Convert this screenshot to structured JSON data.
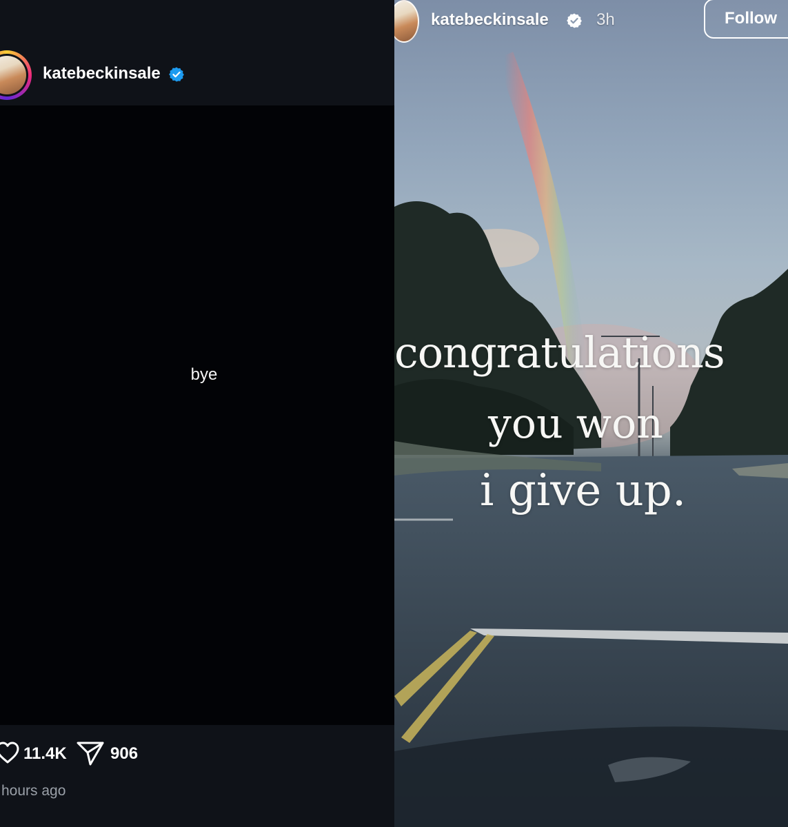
{
  "left_post": {
    "username": "katebeckinsale",
    "text": "bye",
    "likes": "11.4K",
    "shares": "906",
    "time": "hours ago"
  },
  "story": {
    "username": "katebeckinsale",
    "time": "3h",
    "follow_label": "Follow",
    "lines": [
      "congratulations",
      "you won",
      "i give up."
    ]
  },
  "colors": {
    "verified_blue": "#1d9bf0",
    "dark_bg": "#0f1218",
    "post_bg": "#020306"
  },
  "icons": [
    "verified-icon",
    "heart-icon",
    "share-icon"
  ]
}
